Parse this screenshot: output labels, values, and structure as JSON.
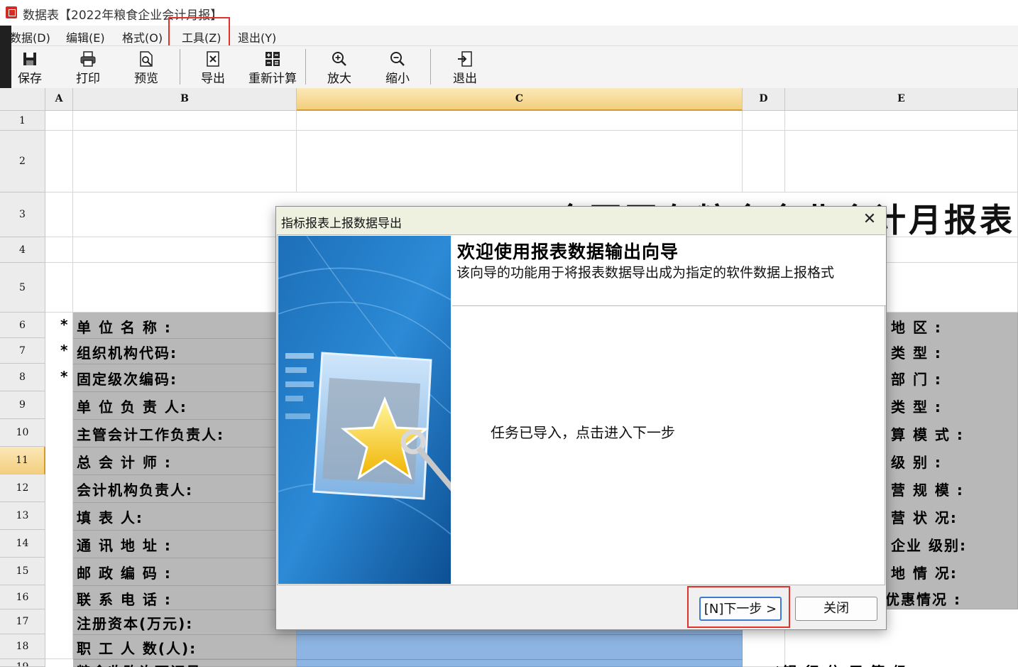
{
  "window": {
    "title": "数据表【2022年粮食企业会计月报】"
  },
  "menu": {
    "items": [
      {
        "label": "数据(D)"
      },
      {
        "label": "编辑(E)"
      },
      {
        "label": "格式(O)"
      },
      {
        "label": "工具(Z)"
      },
      {
        "label": "退出(Y)"
      }
    ]
  },
  "toolbar": {
    "buttons": [
      {
        "label": "保存",
        "icon": "save-icon"
      },
      {
        "label": "打印",
        "icon": "print-icon"
      },
      {
        "label": "预览",
        "icon": "preview-icon"
      },
      {
        "label": "导出",
        "icon": "export-icon"
      },
      {
        "label": "重新计算",
        "icon": "recalculate-icon"
      },
      {
        "label": "放大",
        "icon": "zoom-in-icon"
      },
      {
        "label": "缩小",
        "icon": "zoom-out-icon"
      },
      {
        "label": "退出",
        "icon": "exit-icon"
      }
    ]
  },
  "grid": {
    "columns": [
      "A",
      "B",
      "C",
      "D",
      "E"
    ],
    "selected_column": "C",
    "selected_row": "11",
    "rows": [
      "1",
      "2",
      "3",
      "4",
      "5",
      "6",
      "7",
      "8",
      "9",
      "10",
      "11",
      "12",
      "13",
      "14",
      "15",
      "16",
      "17",
      "18",
      "19"
    ],
    "sheet_title": "全国国有粮食企业会计月报表",
    "left_labels": [
      {
        "star": "*",
        "text": "单 位 名 称 :"
      },
      {
        "star": "*",
        "text": "组织机构代码:"
      },
      {
        "star": "*",
        "text": "固定级次编码:"
      },
      {
        "star": "",
        "text": "单 位 负 责 人:"
      },
      {
        "star": "",
        "text": "主管会计工作负责人:"
      },
      {
        "star": "",
        "text": "总 会 计 师 :"
      },
      {
        "star": "",
        "text": "会计机构负责人:"
      },
      {
        "star": "",
        "text": "填 表 人:"
      },
      {
        "star": "",
        "text": "通 讯 地 址 :"
      },
      {
        "star": "",
        "text": "邮 政 编 码 :"
      },
      {
        "star": "",
        "text": "联 系 电 话 :"
      },
      {
        "star": "",
        "text": "注册资本(万元):"
      },
      {
        "star": "",
        "text": "职 工 人 数(人):"
      },
      {
        "star": "",
        "text": "粮食收购许可证号"
      }
    ],
    "right_labels": [
      {
        "text": "地 区 :"
      },
      {
        "text": "类 型 :"
      },
      {
        "text": "部 门 :"
      },
      {
        "text": "类 型 :"
      },
      {
        "text": "算 模 式 :"
      },
      {
        "text": "级 别 :"
      },
      {
        "text": "营 规 模 :"
      },
      {
        "text": "营 状 况:"
      },
      {
        "text": "企业 级别:"
      },
      {
        "text": "地 情 况:"
      },
      {
        "text": "优惠情况 :"
      },
      {
        "text": ""
      },
      {
        "text": ""
      },
      {
        "text": "*银 行 信 用 等 级"
      }
    ]
  },
  "dialog": {
    "title": "指标报表上报数据导出",
    "heading": "欢迎使用报表数据输出向导",
    "subheading": "该向导的功能用于将报表数据导出成为指定的软件数据上报格式",
    "message": "任务已导入，点击进入下一步",
    "next_button": "[N]下一步 >",
    "close_button": "关闭"
  },
  "colors": {
    "highlight_box": "#e0312b",
    "label_cell_bg": "#b8b8b8",
    "data_cell_bg": "#8db4e2",
    "selected_header": "#f3cf7e",
    "dialog_titlebar": "#eef1e0"
  }
}
